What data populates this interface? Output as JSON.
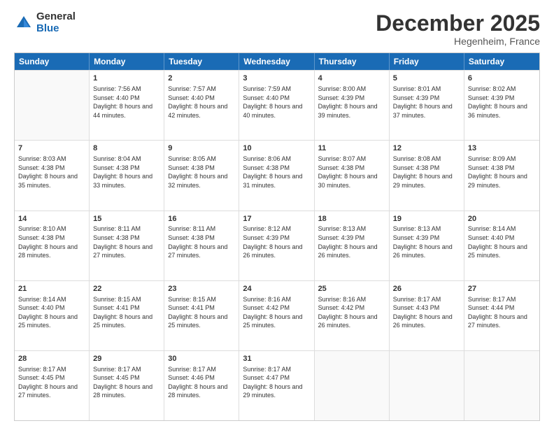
{
  "logo": {
    "general": "General",
    "blue": "Blue"
  },
  "header": {
    "month": "December 2025",
    "location": "Hegenheim, France"
  },
  "days": [
    "Sunday",
    "Monday",
    "Tuesday",
    "Wednesday",
    "Thursday",
    "Friday",
    "Saturday"
  ],
  "weeks": [
    [
      {
        "day": "",
        "empty": true
      },
      {
        "day": "1",
        "sunrise": "Sunrise: 7:56 AM",
        "sunset": "Sunset: 4:40 PM",
        "daylight": "Daylight: 8 hours and 44 minutes."
      },
      {
        "day": "2",
        "sunrise": "Sunrise: 7:57 AM",
        "sunset": "Sunset: 4:40 PM",
        "daylight": "Daylight: 8 hours and 42 minutes."
      },
      {
        "day": "3",
        "sunrise": "Sunrise: 7:59 AM",
        "sunset": "Sunset: 4:40 PM",
        "daylight": "Daylight: 8 hours and 40 minutes."
      },
      {
        "day": "4",
        "sunrise": "Sunrise: 8:00 AM",
        "sunset": "Sunset: 4:39 PM",
        "daylight": "Daylight: 8 hours and 39 minutes."
      },
      {
        "day": "5",
        "sunrise": "Sunrise: 8:01 AM",
        "sunset": "Sunset: 4:39 PM",
        "daylight": "Daylight: 8 hours and 37 minutes."
      },
      {
        "day": "6",
        "sunrise": "Sunrise: 8:02 AM",
        "sunset": "Sunset: 4:39 PM",
        "daylight": "Daylight: 8 hours and 36 minutes."
      }
    ],
    [
      {
        "day": "7",
        "sunrise": "Sunrise: 8:03 AM",
        "sunset": "Sunset: 4:38 PM",
        "daylight": "Daylight: 8 hours and 35 minutes."
      },
      {
        "day": "8",
        "sunrise": "Sunrise: 8:04 AM",
        "sunset": "Sunset: 4:38 PM",
        "daylight": "Daylight: 8 hours and 33 minutes."
      },
      {
        "day": "9",
        "sunrise": "Sunrise: 8:05 AM",
        "sunset": "Sunset: 4:38 PM",
        "daylight": "Daylight: 8 hours and 32 minutes."
      },
      {
        "day": "10",
        "sunrise": "Sunrise: 8:06 AM",
        "sunset": "Sunset: 4:38 PM",
        "daylight": "Daylight: 8 hours and 31 minutes."
      },
      {
        "day": "11",
        "sunrise": "Sunrise: 8:07 AM",
        "sunset": "Sunset: 4:38 PM",
        "daylight": "Daylight: 8 hours and 30 minutes."
      },
      {
        "day": "12",
        "sunrise": "Sunrise: 8:08 AM",
        "sunset": "Sunset: 4:38 PM",
        "daylight": "Daylight: 8 hours and 29 minutes."
      },
      {
        "day": "13",
        "sunrise": "Sunrise: 8:09 AM",
        "sunset": "Sunset: 4:38 PM",
        "daylight": "Daylight: 8 hours and 29 minutes."
      }
    ],
    [
      {
        "day": "14",
        "sunrise": "Sunrise: 8:10 AM",
        "sunset": "Sunset: 4:38 PM",
        "daylight": "Daylight: 8 hours and 28 minutes."
      },
      {
        "day": "15",
        "sunrise": "Sunrise: 8:11 AM",
        "sunset": "Sunset: 4:38 PM",
        "daylight": "Daylight: 8 hours and 27 minutes."
      },
      {
        "day": "16",
        "sunrise": "Sunrise: 8:11 AM",
        "sunset": "Sunset: 4:38 PM",
        "daylight": "Daylight: 8 hours and 27 minutes."
      },
      {
        "day": "17",
        "sunrise": "Sunrise: 8:12 AM",
        "sunset": "Sunset: 4:39 PM",
        "daylight": "Daylight: 8 hours and 26 minutes."
      },
      {
        "day": "18",
        "sunrise": "Sunrise: 8:13 AM",
        "sunset": "Sunset: 4:39 PM",
        "daylight": "Daylight: 8 hours and 26 minutes."
      },
      {
        "day": "19",
        "sunrise": "Sunrise: 8:13 AM",
        "sunset": "Sunset: 4:39 PM",
        "daylight": "Daylight: 8 hours and 26 minutes."
      },
      {
        "day": "20",
        "sunrise": "Sunrise: 8:14 AM",
        "sunset": "Sunset: 4:40 PM",
        "daylight": "Daylight: 8 hours and 25 minutes."
      }
    ],
    [
      {
        "day": "21",
        "sunrise": "Sunrise: 8:14 AM",
        "sunset": "Sunset: 4:40 PM",
        "daylight": "Daylight: 8 hours and 25 minutes."
      },
      {
        "day": "22",
        "sunrise": "Sunrise: 8:15 AM",
        "sunset": "Sunset: 4:41 PM",
        "daylight": "Daylight: 8 hours and 25 minutes."
      },
      {
        "day": "23",
        "sunrise": "Sunrise: 8:15 AM",
        "sunset": "Sunset: 4:41 PM",
        "daylight": "Daylight: 8 hours and 25 minutes."
      },
      {
        "day": "24",
        "sunrise": "Sunrise: 8:16 AM",
        "sunset": "Sunset: 4:42 PM",
        "daylight": "Daylight: 8 hours and 25 minutes."
      },
      {
        "day": "25",
        "sunrise": "Sunrise: 8:16 AM",
        "sunset": "Sunset: 4:42 PM",
        "daylight": "Daylight: 8 hours and 26 minutes."
      },
      {
        "day": "26",
        "sunrise": "Sunrise: 8:17 AM",
        "sunset": "Sunset: 4:43 PM",
        "daylight": "Daylight: 8 hours and 26 minutes."
      },
      {
        "day": "27",
        "sunrise": "Sunrise: 8:17 AM",
        "sunset": "Sunset: 4:44 PM",
        "daylight": "Daylight: 8 hours and 27 minutes."
      }
    ],
    [
      {
        "day": "28",
        "sunrise": "Sunrise: 8:17 AM",
        "sunset": "Sunset: 4:45 PM",
        "daylight": "Daylight: 8 hours and 27 minutes."
      },
      {
        "day": "29",
        "sunrise": "Sunrise: 8:17 AM",
        "sunset": "Sunset: 4:45 PM",
        "daylight": "Daylight: 8 hours and 28 minutes."
      },
      {
        "day": "30",
        "sunrise": "Sunrise: 8:17 AM",
        "sunset": "Sunset: 4:46 PM",
        "daylight": "Daylight: 8 hours and 28 minutes."
      },
      {
        "day": "31",
        "sunrise": "Sunrise: 8:17 AM",
        "sunset": "Sunset: 4:47 PM",
        "daylight": "Daylight: 8 hours and 29 minutes."
      },
      {
        "day": "",
        "empty": true
      },
      {
        "day": "",
        "empty": true
      },
      {
        "day": "",
        "empty": true
      }
    ]
  ]
}
